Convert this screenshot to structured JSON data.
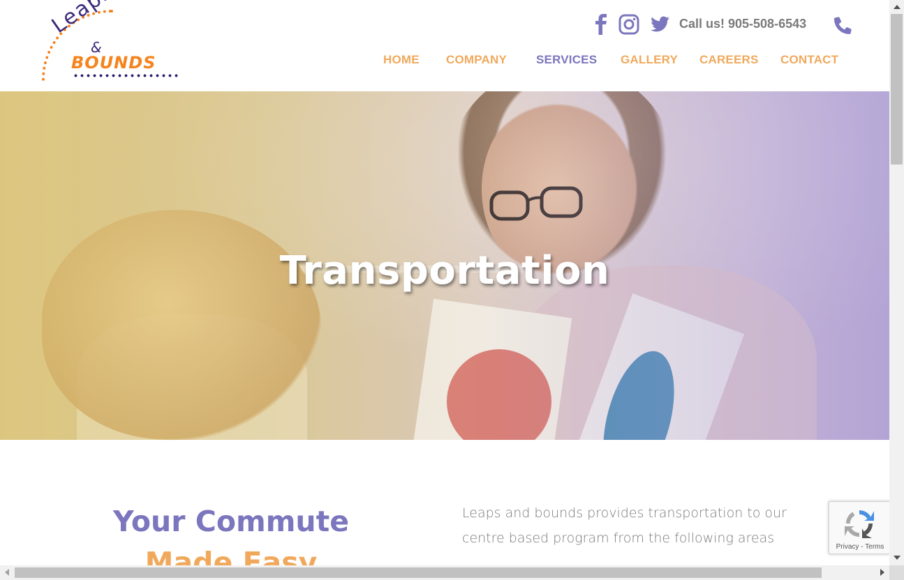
{
  "brand": {
    "logo_word_1": "Leaps",
    "logo_amp": "&",
    "logo_word_2": "BOUNDS"
  },
  "header": {
    "social": [
      "facebook-icon",
      "instagram-icon",
      "twitter-icon"
    ],
    "call_text": "Call us! 905-508-6543",
    "phone_icon": "phone-icon"
  },
  "nav": {
    "items": [
      {
        "label": "HOME"
      },
      {
        "label": "COMPANY"
      },
      {
        "label": "SERVICES",
        "active": true
      },
      {
        "label": "GALLERY"
      },
      {
        "label": "CAREERS"
      },
      {
        "label": "CONTACT"
      }
    ]
  },
  "hero": {
    "title": "Transportation"
  },
  "content": {
    "heading_line_1": "Your Commute",
    "heading_line_2": "Made Easy",
    "paragraph": "Leaps and bounds provides transportation to our centre based program from the following areas"
  },
  "recaptcha": {
    "links": "Privacy - Terms"
  },
  "colors": {
    "purple": "#7b76bd",
    "orange": "#f0a95c",
    "gray_text": "#7a7a7a"
  }
}
